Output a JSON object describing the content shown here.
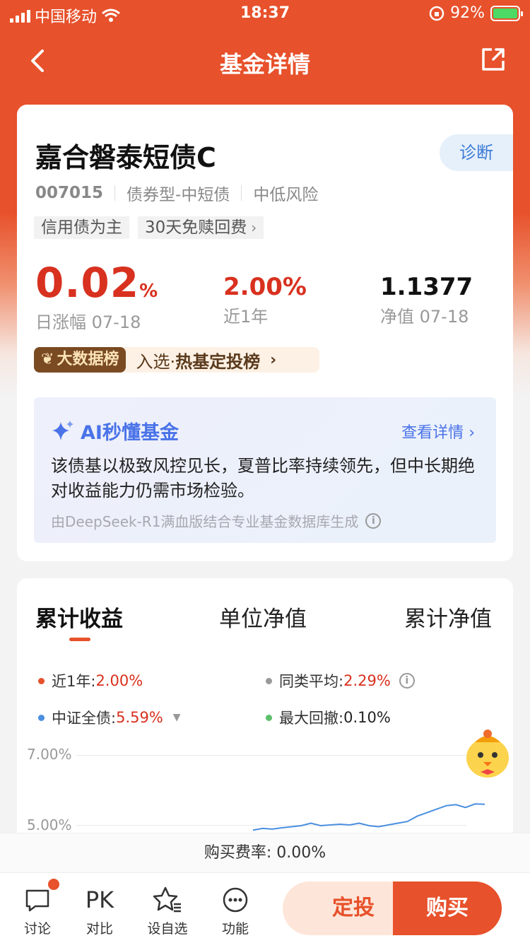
{
  "status_bar": {
    "carrier": "中国移动",
    "time": "18:37",
    "battery": "92%"
  },
  "nav": {
    "title": "基金详情"
  },
  "fund": {
    "name": "嘉合磐泰短债C",
    "diagnose_label": "诊断",
    "code": "007015",
    "type": "债券型-中短债",
    "risk": "中低风险",
    "tags": [
      "信用债为主",
      "30天免赎回费"
    ],
    "daily_change": "0.02",
    "daily_change_unit": "%",
    "daily_change_label": "日涨幅 07-18",
    "year_return": "2.00%",
    "year_return_label": "近1年",
    "nav_value": "1.1377",
    "nav_label": "净值 07-18",
    "rank_badge": "大数据榜",
    "rank_prefix": "入选·",
    "rank_text": "热基定投榜"
  },
  "ai": {
    "title": "AI秒懂基金",
    "more": "查看详情",
    "summary": "该债基以极致风控见长，夏普比率持续领先，但中长期绝对收益能力仍需市场检验。",
    "footer": "由DeepSeek-R1满血版结合专业基金数据库生成"
  },
  "chart_tabs": [
    "累计收益",
    "单位净值",
    "累计净值"
  ],
  "legend": {
    "year_label": "近1年:",
    "year_value": "2.00%",
    "peer_label": "同类平均:",
    "peer_value": "2.29%",
    "index_label": "中证全债:",
    "index_value": "5.59%",
    "drawdown_label": "最大回撤:",
    "drawdown_value": "0.10%"
  },
  "colors": {
    "accent": "#e7512b",
    "up": "#d8311f",
    "ai_blue": "#4a73e8",
    "series_index": "#4a8fe0",
    "series_year": "#e7512b",
    "series_peer": "#999999",
    "series_drawdown": "#5cbf6a"
  },
  "chart_data": {
    "type": "line",
    "ylim_visible": [
      5.0,
      7.0
    ],
    "y_ticks": [
      "7.00%",
      "5.00%"
    ],
    "series": [
      {
        "name": "中证全债",
        "values": [
          4.85,
          4.9,
          4.88,
          4.92,
          4.95,
          4.98,
          5.05,
          4.98,
          5.0,
          5.02,
          5.0,
          5.05,
          4.98,
          4.95,
          5.0,
          5.05,
          5.1,
          5.25,
          5.35,
          5.45,
          5.55,
          5.58,
          5.5,
          5.6,
          5.59
        ]
      }
    ]
  },
  "fee": {
    "label": "购买费率:",
    "value": "0.00%"
  },
  "bottom_bar": {
    "discuss": "讨论",
    "compare_icon": "PK",
    "compare": "对比",
    "watch": "设自选",
    "functions": "功能",
    "invest": "定投",
    "buy": "购买"
  }
}
